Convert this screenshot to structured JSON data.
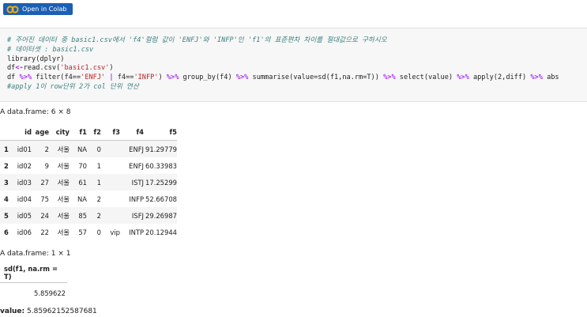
{
  "colab_button": {
    "label": "Open in Colab",
    "icon": "colab-logo-icon",
    "color": "#1a5fb4",
    "logo_color": "#f9ab00"
  },
  "code": {
    "comment1": "# 주어진 데이터 중 basic1.csv에서 'f4'컬럼 값이 'ENFJ'와 'INFP'인 'f1'의 표준편차 차이를 절대값으로 구하시오",
    "comment2": "# 데이터셋 : basic1.csv",
    "line3": "library(dplyr)",
    "line4_var": "df",
    "line4_assign": "<-",
    "line4_call": "read.csv(",
    "line4_str": "'basic1.csv'",
    "line4_close": ")",
    "line5_a": "df ",
    "line5_pipe1": "%>%",
    "line5_b": " filter(f4==",
    "line5_str1": "'ENFJ'",
    "line5_or": " | ",
    "line5_c": "f4==",
    "line5_str2": "'INFP'",
    "line5_d": ") ",
    "line5_pipe2": "%>%",
    "line5_e": " group_by(f4) ",
    "line5_pipe3": "%>%",
    "line5_f": " summarise(value=sd(f1,na.rm=T)) ",
    "line5_pipe4": "%>%",
    "line5_g": " select(value) ",
    "line5_pipe5": "%>%",
    "line5_h": " apply(2,diff) ",
    "line5_pipe6": "%>%",
    "line5_i": " abs",
    "comment6": "#apply 1이 row단위 2가 col 단위 연산"
  },
  "output1": {
    "label": "A data.frame: 6 × 8",
    "headers": [
      "",
      "id",
      "age",
      "city",
      "f1",
      "f2",
      "f3",
      "f4",
      "f5"
    ],
    "rows": [
      [
        "1",
        "id01",
        "2",
        "서울",
        "NA",
        "0",
        "",
        "ENFJ",
        "91.29779"
      ],
      [
        "2",
        "id02",
        "9",
        "서울",
        "70",
        "1",
        "",
        "ENFJ",
        "60.33983"
      ],
      [
        "3",
        "id03",
        "27",
        "서울",
        "61",
        "1",
        "",
        "ISTJ",
        "17.25299"
      ],
      [
        "4",
        "id04",
        "75",
        "서울",
        "NA",
        "2",
        "",
        "INFP",
        "52.66708"
      ],
      [
        "5",
        "id05",
        "24",
        "서울",
        "85",
        "2",
        "",
        "ISFJ",
        "29.26987"
      ],
      [
        "6",
        "id06",
        "22",
        "서울",
        "57",
        "0",
        "vip",
        "INTP",
        "20.12944"
      ]
    ]
  },
  "output2": {
    "label": "A data.frame: 1 × 1",
    "header": "sd(f1, na.rm = T)",
    "value": "5.859622"
  },
  "final": {
    "key": "value:",
    "value": "5.85962152587681"
  }
}
